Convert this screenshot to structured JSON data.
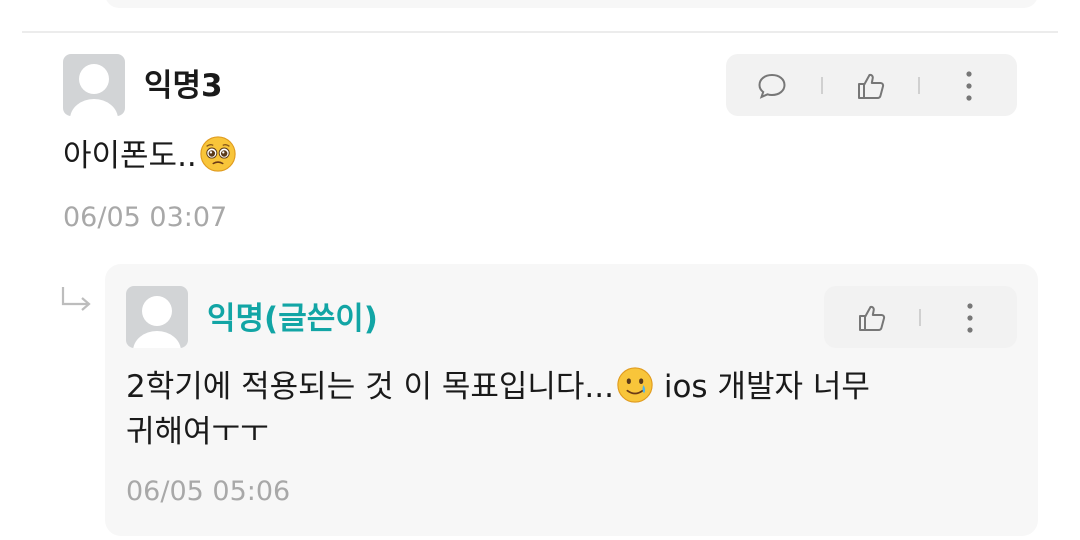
{
  "comment": {
    "author": "익명3",
    "text": "아이폰도..",
    "emoji": "pleading-face-emoji",
    "timestamp": "06/05 03:07",
    "actions": [
      "reply-icon",
      "like-icon",
      "more-icon"
    ]
  },
  "reply": {
    "author": "익명(글쓴이)",
    "text_line1": "2학기에 적용되는 것 이 목표입니다...",
    "emoji": "smiling-face-with-tear-emoji",
    "text_line1_after": " ios 개발자 너무",
    "text_line2": "귀해여ㅜㅜ",
    "timestamp": "06/05 05:06",
    "actions": [
      "like-icon",
      "more-icon"
    ]
  },
  "colors": {
    "writer_name": "#12a5a5",
    "timestamp": "#a8a8a8",
    "action_bg": "#f2f2f2",
    "reply_bg": "#f7f7f7"
  }
}
